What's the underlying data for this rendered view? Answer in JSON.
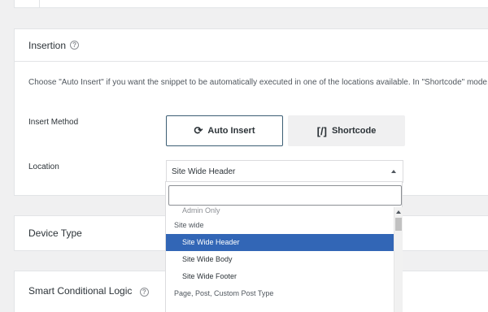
{
  "insertion": {
    "title": "Insertion",
    "help_icon": "?",
    "description": "Choose \"Auto Insert\" if you want the snippet to be automatically executed in one of the locations available. In \"Shortcode\" mode, the",
    "insert_method_label": "Insert Method",
    "auto_insert_label": "Auto Insert",
    "auto_insert_icon": "sync-icon",
    "shortcode_label": "Shortcode",
    "shortcode_icon": "[/]",
    "location_label": "Location",
    "location_selected": "Site Wide Header"
  },
  "dropdown": {
    "search_value": "",
    "options": [
      {
        "label": "Admin Only",
        "type": "disabled-partial"
      },
      {
        "label": "Site wide",
        "type": "group"
      },
      {
        "label": "Site Wide Header",
        "type": "selected"
      },
      {
        "label": "Site Wide Body",
        "type": "option"
      },
      {
        "label": "Site Wide Footer",
        "type": "option"
      },
      {
        "label": "Page, Post, Custom Post Type",
        "type": "group"
      }
    ]
  },
  "device": {
    "title": "Device Type"
  },
  "smart": {
    "title": "Smart Conditional Logic",
    "help_icon": "?"
  },
  "colors": {
    "accent": "#3266b6",
    "button_border": "#3c5e74",
    "page_bg": "#f0f0f1"
  }
}
